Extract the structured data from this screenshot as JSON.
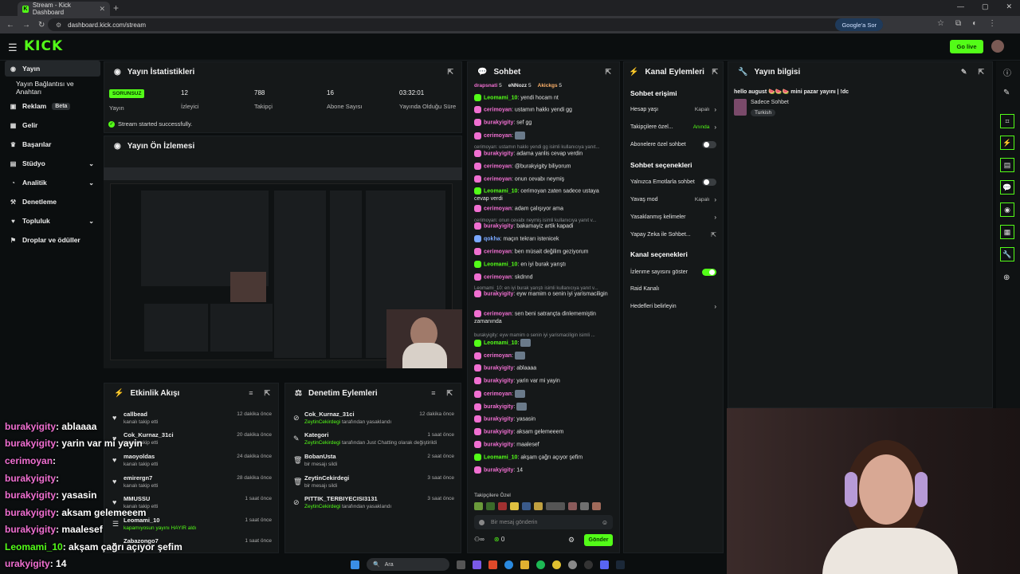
{
  "browser": {
    "tab_title": "Stream - Kick Dashboard",
    "url": "dashboard.kick.com/stream",
    "google_btn": "Google'a Sor"
  },
  "header": {
    "logo": "KICK",
    "go_live": "Go live"
  },
  "nav": {
    "items": [
      {
        "label": "Yayın",
        "icon": "broadcast-icon"
      },
      {
        "label": "Yayın Bağlantısı ve Anahtarı",
        "icon": ""
      },
      {
        "label": "Reklam",
        "icon": "ad-icon",
        "badge": "Beta"
      },
      {
        "label": "Gelir",
        "icon": "money-icon"
      },
      {
        "label": "Başarılar",
        "icon": "trophy-icon"
      },
      {
        "label": "Stüdyo",
        "icon": "studio-icon"
      },
      {
        "label": "Analitik",
        "icon": "chart-icon"
      },
      {
        "label": "Denetleme",
        "icon": "shield-icon"
      },
      {
        "label": "Topluluk",
        "icon": "community-icon"
      },
      {
        "label": "Droplar ve ödüller",
        "icon": "gift-icon"
      }
    ]
  },
  "stats": {
    "title": "Yayın İstatistikleri",
    "badge": "SORUNSUZ",
    "items": [
      {
        "value": "",
        "label": "Yayın"
      },
      {
        "value": "12",
        "label": "İzleyici"
      },
      {
        "value": "788",
        "label": "Takipçi"
      },
      {
        "value": "16",
        "label": "Abone Sayısı"
      },
      {
        "value": "03:32:01",
        "label": "Yayında Olduğu Süre"
      }
    ],
    "status": "Stream started successfully."
  },
  "preview": {
    "title": "Yayın Ön İzlemesi"
  },
  "activity": {
    "title": "Etkinlik Akışı",
    "rows": [
      {
        "name": "callbead",
        "sub": "kanalı takip etti",
        "time": "12 dakika önce"
      },
      {
        "name": "Cok_Kurnaz_31ci",
        "sub": "kanalı takip etti",
        "time": "20 dakika önce"
      },
      {
        "name": "maoyoldas",
        "sub": "kanalı takip etti",
        "time": "24 dakika önce"
      },
      {
        "name": "emirergn7",
        "sub": "kanalı takip etti",
        "time": "28 dakika önce"
      },
      {
        "name": "MMUSSU",
        "sub": "kanalı takip etti",
        "time": "1 saat önce"
      },
      {
        "name": "Leomami_10",
        "sub": "kapamıyosun yayını HAYIR aldı",
        "time": "1 saat önce"
      },
      {
        "name": "Zabazongo7",
        "sub": "",
        "time": "1 saat önce"
      }
    ]
  },
  "moderation": {
    "title": "Denetim Eylemleri",
    "rows": [
      {
        "name": "Cok_Kurnaz_31ci",
        "who": "ZeytinCekirdegi",
        "rest": " tarafından yasaklandı",
        "time": "12 dakika önce"
      },
      {
        "name": "Kategori",
        "who": "ZeytinCekirdegi",
        "rest": " tarafından Just Chatting olarak değiştirildi",
        "time": "1 saat önce"
      },
      {
        "name": "BobanUsta",
        "who": "",
        "rest": "bir mesajı sildi",
        "time": "2 saat önce"
      },
      {
        "name": "ZeytinCekirdegi",
        "who": "",
        "rest": "bir mesajı sildi",
        "time": "3 saat önce"
      },
      {
        "name": "PITTIK_TERBIYECISI3131",
        "who": "ZeytinCekirdegi",
        "rest": " tarafından yasaklandı",
        "time": "3 saat önce"
      }
    ]
  },
  "chat": {
    "title": "Sohbet",
    "top_gifters": [
      {
        "name": "drapsnati",
        "n": "5"
      },
      {
        "name": "eNNozz",
        "n": "5"
      },
      {
        "name": "Akickgs",
        "n": "5"
      }
    ],
    "lines": [
      {
        "user": "Leomami_10",
        "color": "green",
        "msg": "yendi hocam nt"
      },
      {
        "user": "cerimoyan",
        "color": "pink",
        "msg": "ustamın hakkı yendi gg"
      },
      {
        "user": "burakyigity",
        "color": "pink",
        "msg": "sef gg"
      },
      {
        "user": "cerimoyan",
        "color": "pink",
        "msg": ""
      },
      {
        "sys": "cerimoyan: ustamın hakkı yendi gg isimli kullanıcıya yanıt..."
      },
      {
        "user": "burakyigity",
        "color": "pink",
        "msg": "adama yanlis cevap verdin"
      },
      {
        "user": "cerimoyan",
        "color": "pink",
        "msg": "@burakyigity biliyorum"
      },
      {
        "user": "cerimoyan",
        "color": "pink",
        "msg": "onun cevabı neymiş"
      },
      {
        "user": "Leomami_10",
        "color": "green",
        "msg": "cerimoyan zaten sadece ustaya cevap verdi"
      },
      {
        "user": "cerimoyan",
        "color": "pink",
        "msg": "adam çalışıyor ama"
      },
      {
        "sys": "cerimoyan: onun cevabı neymiş isimli kullanıcıya yanıt v..."
      },
      {
        "user": "burakyigity",
        "color": "pink",
        "msg": "bakamayiz artik kapadi"
      },
      {
        "user": "qokha",
        "color": "blue",
        "msg": "maçın tekrarı istenicek"
      },
      {
        "user": "cerimoyan",
        "color": "pink",
        "msg": "ben müsait değilim geziyorum"
      },
      {
        "user": "Leomami_10",
        "color": "green",
        "msg": "en iyi burak yarıştı"
      },
      {
        "user": "cerimoyan",
        "color": "pink",
        "msg": "skdnnd"
      },
      {
        "sys": "Leomami_10: en iyi burak yarıştı isimli kullanıcıya yanıt v..."
      },
      {
        "user": "burakyigity",
        "color": "pink",
        "msg": "eyw mamim o senin iyi yarismaciligin"
      },
      {
        "user": "cerimoyan",
        "color": "pink",
        "msg": "sen beni satrançta dinlememiştin zamanında"
      },
      {
        "sys": "burakyigity: eyw mamim o senin iyi yarismaciligin isimli ..."
      },
      {
        "user": "Leomami_10",
        "color": "green",
        "msg": ""
      },
      {
        "user": "cerimoyan",
        "color": "pink",
        "msg": ""
      },
      {
        "user": "burakyigity",
        "color": "pink",
        "msg": "ablaaaa"
      },
      {
        "user": "burakyigity",
        "color": "pink",
        "msg": "yarin var mi yayin"
      },
      {
        "user": "cerimoyan",
        "color": "pink",
        "msg": ""
      },
      {
        "user": "burakyigity",
        "color": "pink",
        "msg": ""
      },
      {
        "user": "burakyigity",
        "color": "pink",
        "msg": "yasasin"
      },
      {
        "user": "burakyigity",
        "color": "pink",
        "msg": "aksam gelemeeem"
      },
      {
        "user": "burakyigity",
        "color": "pink",
        "msg": "maalesef"
      },
      {
        "user": "Leomami_10",
        "color": "green",
        "msg": "akşam çağrı açıyor şefim"
      },
      {
        "user": "burakyigity",
        "color": "pink",
        "msg": "14"
      }
    ],
    "followers_only": "Takipçilere Özel",
    "placeholder": "Bir mesaj gönderin",
    "points": "0",
    "send": "Gönder",
    "infinity": "∞"
  },
  "channel_actions": {
    "title": "Kanal Eylemleri",
    "items": [
      {
        "type": "h",
        "label": "Sohbet erişimi"
      },
      {
        "type": "chev",
        "label": "Hesap yaşı",
        "value": "Kapalı"
      },
      {
        "type": "chev",
        "label": "Takipçilere özel...",
        "value": "Anında",
        "green": true
      },
      {
        "type": "toggle",
        "label": "Abonelere özel sohbet",
        "on": false
      },
      {
        "type": "h",
        "label": "Sohbet seçenekleri"
      },
      {
        "type": "toggle",
        "label": "Yalnızca Emotlarla sohbet",
        "on": false
      },
      {
        "type": "chev",
        "label": "Yavaş mod",
        "value": "Kapalı"
      },
      {
        "type": "chev",
        "label": "Yasaklanmış kelimeler",
        "value": ""
      },
      {
        "type": "ext",
        "label": "Yapay Zeka ile Sohbet...",
        "value": ""
      },
      {
        "type": "h",
        "label": "Kanal seçenekleri"
      },
      {
        "type": "toggle",
        "label": "İzlenme sayısını göster",
        "on": true
      },
      {
        "type": "plain",
        "label": "Raid Kanalı"
      },
      {
        "type": "chev",
        "label": "Hedefleri belirleyin",
        "value": ""
      }
    ]
  },
  "stream_info": {
    "title": "Yayın bilgisi",
    "stream_title": "hello august 🍉🍉🍉 mini pazar yayını | !dc",
    "category": "Sadece Sohbet",
    "tag": "Turkish"
  },
  "overlay_chat": [
    {
      "user": "burakyigity",
      "msg": ": ablaaaa",
      "color": "#f06fd1"
    },
    {
      "user": "burakyigity",
      "msg": ": yarin var mi yayin",
      "color": "#f06fd1"
    },
    {
      "user": "cerimoyan",
      "msg": ":",
      "color": "#f06fd1"
    },
    {
      "user": "burakyigity",
      "msg": ":",
      "color": "#f06fd1"
    },
    {
      "user": "burakyigity",
      "msg": ": yasasin",
      "color": "#f06fd1"
    },
    {
      "user": "burakyigity",
      "msg": ": aksam gelemeeem",
      "color": "#f06fd1"
    },
    {
      "user": "burakyigity",
      "msg": ": maalesef",
      "color": "#f06fd1"
    },
    {
      "user": "Leomami_10",
      "msg": ": akşam çağrı açıyor şefim",
      "color": "#53fc18"
    },
    {
      "user": "urakyigity",
      "msg": ": 14",
      "color": "#f06fd1"
    }
  ],
  "taskbar": {
    "search": "Ara"
  }
}
